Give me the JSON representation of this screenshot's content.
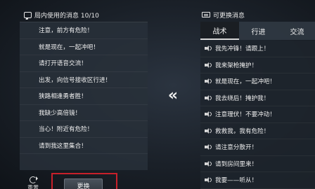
{
  "left_panel": {
    "title": "局内使用的消息 10/10",
    "items": [
      "注意，前方有危险！",
      "就是现在，一起冲吧！",
      "请打开语音交流！",
      "出发，向信号接收区行进！",
      "狭路相逢勇者胜！",
      "我缺少高倍镜！",
      "当心！附近有危险！",
      "请到我这里集合！"
    ],
    "reset_label": "重置",
    "change_label": "更换"
  },
  "swap_arrow": "«",
  "right_panel": {
    "title": "可更换消息",
    "tabs": [
      "战术",
      "行进",
      "交流"
    ],
    "active_tab": 0,
    "items": [
      "我先冲锋！请跟上！",
      "我来架枪掩护！",
      "就是现在，一起冲吧！",
      "我去绕后！掩护我！",
      "注意理伏！不要冲动！",
      "救救我，我有危险！",
      "请注意分散开！",
      "请到房间里来！",
      "我要——听从！"
    ]
  },
  "colors": {
    "highlight_border": "#c8202a",
    "active_tab_bg": "#1a1e23"
  }
}
